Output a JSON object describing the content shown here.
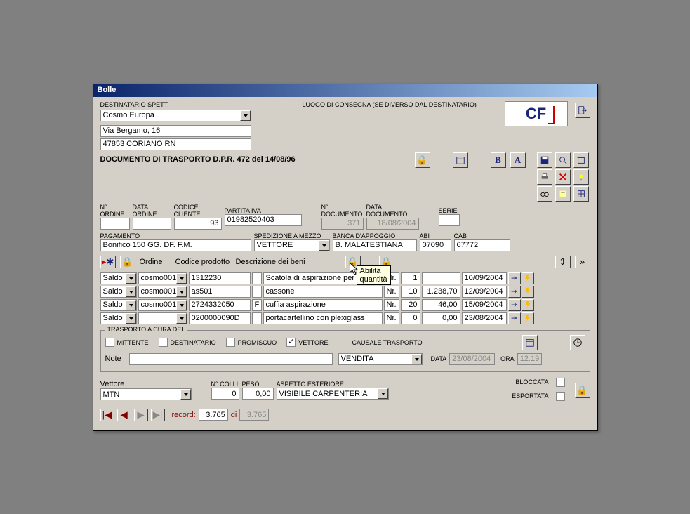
{
  "window": {
    "title": "Bolle"
  },
  "header": {
    "destinatario_label": "DESTINATARIO SPETT.",
    "luogo_label": "LUOGO DI CONSEGNA (SE DIVERSO DAL DESTINATARIO)",
    "destinatario": "Cosmo Europa",
    "address": "Via Bergamo, 16",
    "city": "47853 CORIANO RN",
    "logo_text": "CF"
  },
  "doc": {
    "title": "DOCUMENTO DI TRASPORTO D.P.R. 472 del 14/08/96",
    "col_nordine": "N° ORDINE",
    "col_dataordine": "DATA ORDINE",
    "col_codicecliente": "CODICE CLIENTE",
    "col_partitaiva": "PARTITA IVA",
    "col_ndocumento": "N° DOCUMENTO",
    "col_datadocumento": "DATA DOCUMENTO",
    "col_serie": "SERIE",
    "codicecliente": "93",
    "partitaiva": "01982520403",
    "ndocumento": "371",
    "datadocumento": "18/08/2004"
  },
  "pay": {
    "pagamento_label": "PAGAMENTO",
    "pagamento": "Bonifico 150 GG. DF. F.M.",
    "spedizione_label": "SPEDIZIONE A MEZZO",
    "spedizione": "VETTORE",
    "banca_label": "BANCA D'APPOGGIO",
    "banca": "B. MALATESTIANA",
    "abi_label": "ABI",
    "abi": "07090",
    "cab_label": "CAB",
    "cab": "67772"
  },
  "grid": {
    "col_ordine": "Ordine",
    "col_codice": "Codice prodotto",
    "col_descrizione": "Descrizione dei beni",
    "rows": [
      {
        "ordine": "Saldo",
        "cliente": "cosmo001",
        "codice": "1312230",
        "flag": "",
        "descrizione": "Scatola di aspirazione per utensile c",
        "nr": "Nr.",
        "qty": "1",
        "prezzo": "",
        "data": "10/09/2004"
      },
      {
        "ordine": "Saldo",
        "cliente": "cosmo001",
        "codice": "as501",
        "flag": "",
        "descrizione": "cassone",
        "nr": "Nr.",
        "qty": "10",
        "prezzo": "1.238,70",
        "data": "12/09/2004"
      },
      {
        "ordine": "Saldo",
        "cliente": "cosmo001",
        "codice": "2724332050",
        "flag": "F",
        "descrizione": "cuffia aspirazione",
        "nr": "Nr.",
        "qty": "20",
        "prezzo": "46,00",
        "data": "15/09/2004"
      },
      {
        "ordine": "Saldo",
        "cliente": "",
        "codice": "0200000090D",
        "flag": "",
        "descrizione": "portacartellino con plexiglass",
        "nr": "Nr.",
        "qty": "0",
        "prezzo": "0,00",
        "data": "23/08/2004"
      }
    ]
  },
  "tooltip": "Abilita quantità",
  "trasporto": {
    "title": "TRASPORTO A CURA DEL",
    "mittente": "MITTENTE",
    "destinatario": "DESTINATARIO",
    "promiscuo": "PROMISCUO",
    "vettore": "VETTORE",
    "causale_label": "CAUSALE TRASPORTO",
    "causale": "VENDITA",
    "note_label": "Note",
    "data_label": "DATA",
    "data": "23/08/2004",
    "ora_label": "ORA",
    "ora": "12.19"
  },
  "vettore": {
    "vettore_label": "Vettore",
    "vettore": "MTN",
    "ncolli_label": "N° COLLI",
    "ncolli": "0",
    "peso_label": "PESO",
    "peso": "0,00",
    "aspetto_label": "ASPETTO ESTERIORE",
    "aspetto": "VISIBILE CARPENTERIA",
    "bloccata_label": "BLOCCATA",
    "esportata_label": "ESPORTATA"
  },
  "nav": {
    "record_label": "record:",
    "current": "3.765",
    "di": "di",
    "total": "3.765"
  }
}
